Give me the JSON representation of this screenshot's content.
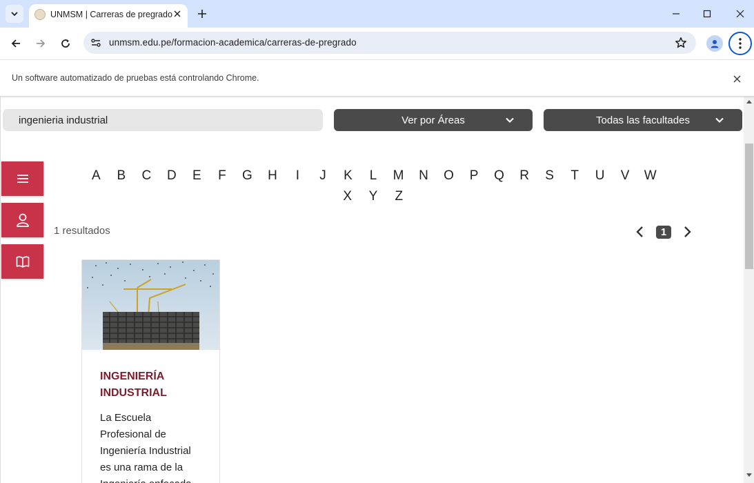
{
  "browser": {
    "tab_title": "UNMSM | Carreras de pregrado",
    "url": "unmsm.edu.pe/formacion-academica/carreras-de-pregrado",
    "infobar_text": "Un software automatizado de pruebas está controlando Chrome."
  },
  "page": {
    "search_value": "ingenieria industrial",
    "areas_select": "Ver por Áreas",
    "faculties_select": "Todas las facultades",
    "alphabet_row1": [
      "A",
      "B",
      "C",
      "D",
      "E",
      "F",
      "G",
      "H",
      "I",
      "J",
      "K",
      "L",
      "M",
      "N",
      "O",
      "P",
      "Q",
      "R",
      "S",
      "T",
      "U",
      "V",
      "W"
    ],
    "alphabet_row2": [
      "X",
      "Y",
      "Z"
    ],
    "results_text": "1 resultados",
    "current_page": "1",
    "card": {
      "title": "INGENIERÍA INDUSTRIAL",
      "text": "La Escuela Profesional de Ingeniería Industrial es una rama de la Ingeniería enfocada"
    }
  },
  "colors": {
    "accent_red": "#c8334a",
    "title_maroon": "#7b1d2a",
    "select_dark": "#4a4a4a"
  }
}
